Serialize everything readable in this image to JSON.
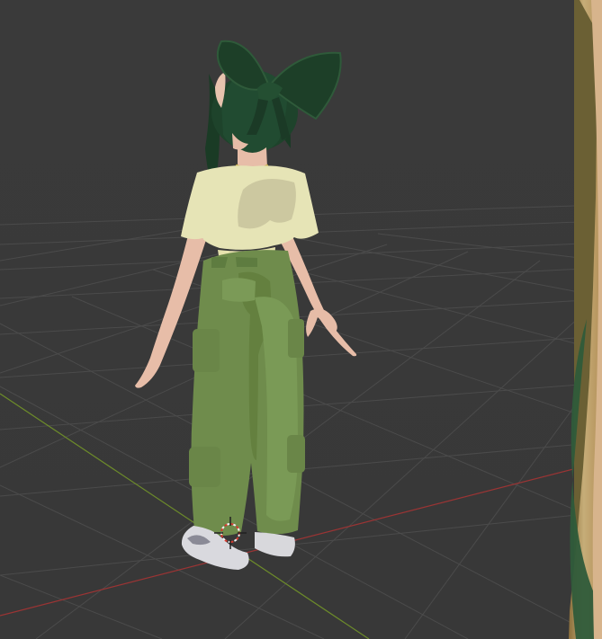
{
  "viewport": {
    "background": "#3b3b3b",
    "grid_color": "#4a4a4a",
    "x_axis_color": "#a23a3a",
    "y_axis_color": "#6c8a2a",
    "cursor_3d": "3d-cursor-icon"
  },
  "character": {
    "hair_color": "#1d3f28",
    "shirt_color": "#e6e4b6",
    "pants_color": "#6f8c4c",
    "skin_color": "#e8bca8",
    "shoe_color": "#d8d8dc"
  },
  "side_image": {
    "colors": [
      "#b9a46e",
      "#7c6433",
      "#2f5b3a",
      "#d9b48d"
    ]
  }
}
